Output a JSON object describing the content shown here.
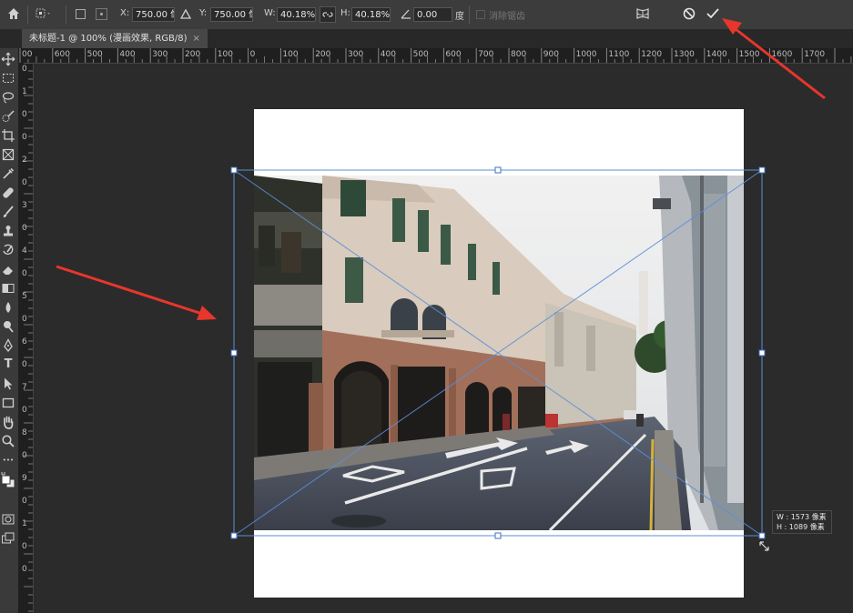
{
  "options_bar": {
    "x_label": "X:",
    "x_value": "750.00 像素",
    "y_label": "Y:",
    "y_value": "750.00 像素",
    "w_label": "W:",
    "w_value": "40.18%",
    "h_label": "H:",
    "h_value": "40.18%",
    "angle_value": "0.00",
    "angle_unit": "度",
    "antialias_label": "消除锯齿"
  },
  "document_tab": {
    "title": "未标题-1 @ 100% (漫画效果, RGB/8)",
    "close": "×"
  },
  "ruler_top": [
    "00",
    "600",
    "500",
    "400",
    "300",
    "200",
    "100",
    "0",
    "100",
    "200",
    "300",
    "400",
    "500",
    "600",
    "700",
    "800",
    "900",
    "1000",
    "1100",
    "1200",
    "1300",
    "1400",
    "1500",
    "1600",
    "1700"
  ],
  "ruler_left_digits": [
    "0",
    "1",
    "0",
    "0",
    "2",
    "0",
    "3",
    "0",
    "4",
    "0",
    "5",
    "0",
    "6",
    "0",
    "7",
    "0",
    "8",
    "0",
    "9",
    "0",
    "1",
    "0",
    "0"
  ],
  "tools": [
    "move-icon",
    "marquee-icon",
    "lasso-icon",
    "quick-select-icon",
    "crop-icon",
    "frame-icon",
    "eyedropper-icon",
    "healing-icon",
    "brush-icon",
    "stamp-icon",
    "history-brush-icon",
    "eraser-icon",
    "gradient-icon",
    "blur-icon",
    "dodge-icon",
    "pen-icon",
    "type-icon",
    "path-select-icon",
    "rectangle-icon",
    "hand-icon",
    "zoom-icon",
    "more-icon"
  ],
  "tool_text": {
    "type": "T",
    "more": "•••"
  },
  "transform_tooltip": {
    "w_line": "W : 1573 像素",
    "h_line": "H : 1089 像素"
  },
  "colors": {
    "annotation_arrow": "#e8362d",
    "handle_border": "#5b8fd8",
    "app_bg": "#282828",
    "panel_bg": "#3c3c3c"
  }
}
